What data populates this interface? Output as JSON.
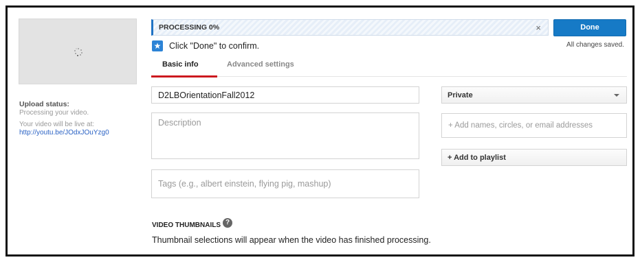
{
  "upload": {
    "status_label": "Upload status:",
    "status_text": "Processing your video.",
    "live_text": "Your video will be live at:",
    "video_url": "http://youtu.be/JOdxJOuYzg0"
  },
  "progress": {
    "label": "PROCESSING 0%",
    "percent": 0,
    "close_glyph": "×"
  },
  "actions": {
    "done_label": "Done",
    "saved_text": "All changes saved.",
    "confirm_text": "Click \"Done\" to confirm."
  },
  "tabs": [
    {
      "label": "Basic info",
      "active": true
    },
    {
      "label": "Advanced settings",
      "active": false
    }
  ],
  "form": {
    "title_value": "D2LBOrientationFall2012",
    "description_placeholder": "Description",
    "tags_placeholder": "Tags (e.g., albert einstein, flying pig, mashup)",
    "privacy_value": "Private",
    "share_placeholder": "+ Add names, circles, or email addresses",
    "playlist_label": "+ Add to playlist"
  },
  "thumbnails": {
    "heading": "VIDEO THUMBNAILS",
    "help_glyph": "?",
    "note": "Thumbnail selections will appear when the video has finished processing."
  },
  "icons": {
    "confirm": "star-icon",
    "thumbnail": "loading-spinner-icon",
    "help": "help-icon",
    "close": "close-icon",
    "dropdown": "caret-down-icon"
  },
  "colors": {
    "accent_blue": "#167ac6",
    "tab_red": "#cc181e",
    "link_blue": "#2a62c4"
  }
}
